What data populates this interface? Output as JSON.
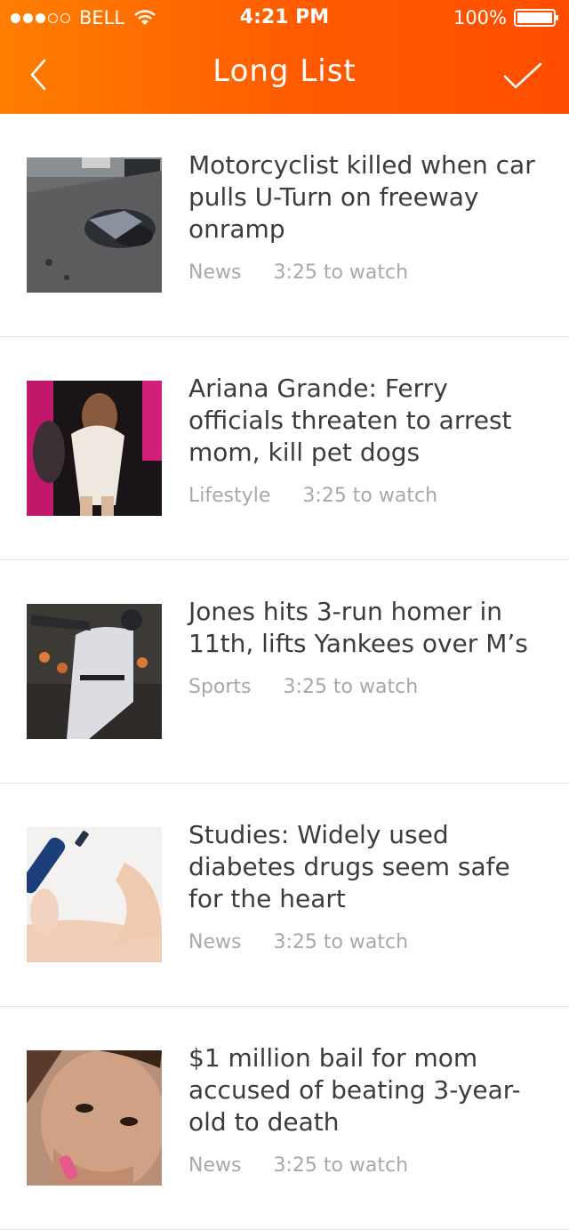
{
  "status_bar": {
    "carrier": "BELL",
    "time": "4:21 PM",
    "battery": "100%"
  },
  "nav": {
    "title": "Long List",
    "back_icon": "chevron-left-icon",
    "done_icon": "checkmark-icon"
  },
  "colors": {
    "accent_start": "#ff7e00",
    "accent_end": "#ff4d00",
    "meta_text": "#a8a8a8"
  },
  "items": [
    {
      "headline": "Motorcyclist killed when car pulls U-Turn on freeway onramp",
      "category": "News",
      "duration": "3:25 to watch"
    },
    {
      "headline": "Ariana Grande: Ferry officials threaten to arrest mom, kill pet dogs",
      "category": "Lifestyle",
      "duration": "3:25 to watch"
    },
    {
      "headline": "Jones hits 3-run homer in 11th, lifts Yankees over M’s",
      "category": "Sports",
      "duration": "3:25 to watch"
    },
    {
      "headline": "Studies: Widely used diabetes drugs seem safe for the heart",
      "category": "News",
      "duration": "3:25 to watch"
    },
    {
      "headline": "$1 million bail for mom accused of beating 3-year-old to death",
      "category": "News",
      "duration": "3:25 to watch"
    }
  ]
}
